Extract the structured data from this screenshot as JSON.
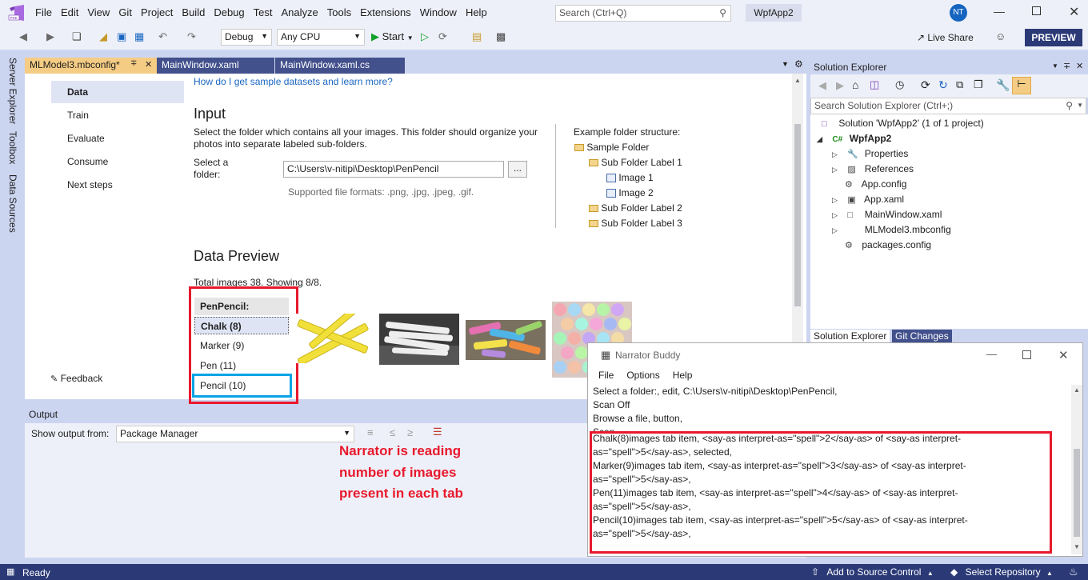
{
  "menubar": {
    "items": [
      "File",
      "Edit",
      "View",
      "Git",
      "Project",
      "Build",
      "Debug",
      "Test",
      "Analyze",
      "Tools",
      "Extensions",
      "Window",
      "Help"
    ],
    "search_placeholder": "Search (Ctrl+Q)",
    "solution_name": "WpfApp2",
    "user_initials": "NT"
  },
  "toolbar": {
    "config": "Debug",
    "platform": "Any CPU",
    "start_label": "Start",
    "live_share": "Live Share",
    "preview": "PREVIEW"
  },
  "side_tabs": [
    "Server Explorer",
    "Toolbox",
    "Data Sources"
  ],
  "doc_tabs": [
    "MLModel3.mbconfig*",
    "MainWindow.xaml",
    "MainWindow.xaml.cs"
  ],
  "nav": {
    "items": [
      "Data",
      "Train",
      "Evaluate",
      "Consume",
      "Next steps"
    ],
    "feedback": "Feedback"
  },
  "data_page": {
    "help_link": "How do I get sample datasets and learn more?",
    "input_title": "Input",
    "input_desc_1": "Select the folder which contains all your images. This folder should organize your",
    "input_desc_2": "photos into separate labeled sub-folders.",
    "folder_label_1": "Select a",
    "folder_label_2": "folder:",
    "folder_value": "C:\\Users\\v-nitipi\\Desktop\\PenPencil",
    "browse_label": "...",
    "formats": "Supported file formats: .png, .jpg, .jpeg, .gif.",
    "example_title": "Example folder structure:",
    "example_tree": [
      "Sample Folder",
      "Sub Folder Label 1",
      "Image 1",
      "Image 2",
      "Sub Folder Label 2",
      "Sub Folder Label 3"
    ],
    "preview_title": "Data Preview",
    "total": "Total images 38. Showing 8/8.",
    "tabs_header": "PenPencil:",
    "tabs": [
      "Chalk (8)",
      "Marker (9)",
      "Pen (11)",
      "Pencil (10)"
    ]
  },
  "annotation": {
    "lines": [
      "Narrator is reading",
      "number of images",
      "present in each tab"
    ]
  },
  "output": {
    "title": "Output",
    "show_from_label": "Show output from:",
    "source": "Package Manager"
  },
  "solution_explorer": {
    "title": "Solution Explorer",
    "search_placeholder": "Search Solution Explorer (Ctrl+;)",
    "solution": "Solution 'WpfApp2' (1 of 1 project)",
    "project": "WpfApp2",
    "items": [
      "Properties",
      "References",
      "App.config",
      "App.xaml",
      "MainWindow.xaml",
      "MLModel3.mbconfig",
      "packages.config"
    ],
    "tabs": [
      "Solution Explorer",
      "Git Changes"
    ]
  },
  "narrator": {
    "title": "Narrator Buddy",
    "menu": [
      "File",
      "Options",
      "Help"
    ],
    "lines": [
      "Select a folder:, edit, C:\\Users\\v-nitipi\\Desktop\\PenPencil,",
      "Scan Off",
      "Browse a file, button,",
      "Scan",
      "Chalk(8)images tab item, <say-as interpret-as=\"spell\">2</say-as> of <say-as interpret-",
      "as=\"spell\">5</say-as>, selected,",
      "Marker(9)images tab item, <say-as interpret-as=\"spell\">3</say-as> of <say-as interpret-",
      "as=\"spell\">5</say-as>,",
      "Pen(11)images tab item, <say-as interpret-as=\"spell\">4</say-as> of <say-as interpret-",
      "as=\"spell\">5</say-as>,",
      "Pencil(10)images tab item, <say-as interpret-as=\"spell\">5</say-as> of <say-as interpret-",
      "as=\"spell\">5</say-as>,"
    ]
  },
  "status": {
    "left": "Ready",
    "source_control": "Add to Source Control",
    "repository": "Select Repository"
  },
  "colors": {
    "accent": "#2b3a77",
    "highlight": "#e8192c",
    "focus": "#0aa4e6",
    "tab_active": "#f5cc84"
  }
}
